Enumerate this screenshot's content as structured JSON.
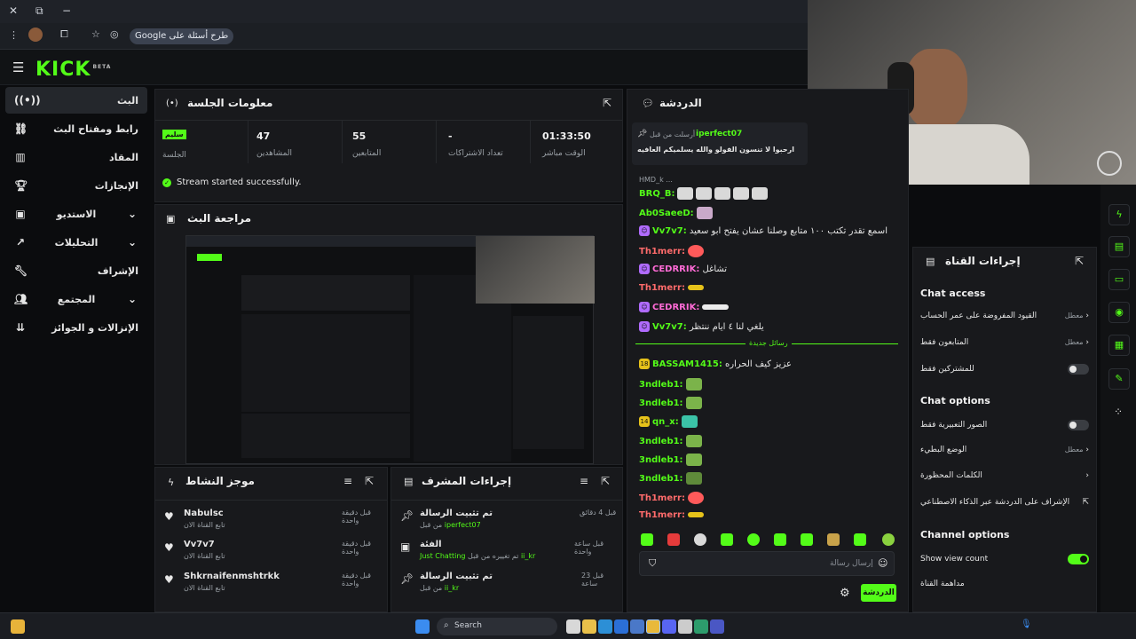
{
  "browser": {
    "address_pill": "Google طرح أسئلة على"
  },
  "kick": {
    "logo": "KICK",
    "logo_sup": "BETA"
  },
  "sidebar": {
    "items": [
      {
        "label": "البث",
        "icon": "broadcast-icon"
      },
      {
        "label": "رابط ومفتاح البث",
        "icon": "link-icon"
      },
      {
        "label": "المقاد",
        "icon": "chart-icon"
      },
      {
        "label": "الإنجازات",
        "icon": "trophy-icon"
      },
      {
        "label": "الاستديو",
        "icon": "studio-icon"
      },
      {
        "label": "التحليلات",
        "icon": "analytics-icon"
      },
      {
        "label": "الإشراف",
        "icon": "wrench-icon"
      },
      {
        "label": "المجتمع",
        "icon": "community-icon"
      },
      {
        "label": "الإنزالات و الجوائز",
        "icon": "drops-icon"
      }
    ]
  },
  "session": {
    "title": "معلومات الجلسة",
    "stats": [
      {
        "value": "01:33:50",
        "label": "الوقت مباشر"
      },
      {
        "value": "-",
        "label": "تعداد الاشتراكات"
      },
      {
        "value": "55",
        "label": "المتابعين"
      },
      {
        "value": "47",
        "label": "المشاهدين"
      },
      {
        "value": "سليم",
        "label": "الجلسة"
      }
    ],
    "status": "Stream started successfully."
  },
  "preview": {
    "title": "مراجعة البث"
  },
  "activity": {
    "title": "موجز النشاط",
    "items": [
      {
        "name": "Nabulsc",
        "sub": "تابع القناة الان",
        "time": "قبل دقيقة واحدة"
      },
      {
        "name": "Vv7v7",
        "sub": "تابع القناة الان",
        "time": "قبل دقيقة واحدة"
      },
      {
        "name": "Shkrnaifenmshtrkk",
        "sub": "تابع القناة الان",
        "time": "قبل دقيقة واحدة"
      }
    ]
  },
  "mod": {
    "title": "إجراءات المشرف",
    "items": [
      {
        "title": "تم تثبيت الرسالة",
        "sub_prefix": "من قبل",
        "user": "iperfect07",
        "time": "قبل 4 دقائق"
      },
      {
        "title": "الفئة",
        "sub_prefix": "تم تغييره من قبل",
        "user": "ii_kr",
        "extra": "Just Chatting",
        "time": "قبل ساعة واحدة"
      },
      {
        "title": "تم تثبيت الرسالة",
        "sub_prefix": "من قبل",
        "user": "ii_kr",
        "time": "قبل 23 ساعة"
      }
    ]
  },
  "chat": {
    "title": "الدردشة",
    "pinned_header": "أرسلت من قبل",
    "pinned_user": "iperfect07",
    "pinned_text": "ارحبوا لا تنسون الفولو والله يسلميكم العافيه",
    "reply_hint": "HMD_k ...",
    "messages": [
      {
        "user": "BRQ_B:",
        "color": "#53fc18",
        "text": ""
      },
      {
        "user": "Ab0SaeeD:",
        "color": "#53fc18",
        "text": ""
      },
      {
        "user": "Vv7v7:",
        "color": "#53fc18",
        "text": "اسمع تقدر تكتب ١٠٠ متابع وصلنا عشان يفتح ابو سعيد"
      },
      {
        "user": "Th1merr:",
        "color": "#ff6b6b",
        "text": ""
      },
      {
        "user": "CEDRRIK:",
        "color": "#ff6bd6",
        "text": "تشاغل"
      },
      {
        "user": "Th1merr:",
        "color": "#ff6b6b",
        "text": ""
      },
      {
        "user": "CEDRRIK:",
        "color": "#ff6bd6",
        "text": ""
      },
      {
        "user": "Vv7v7:",
        "color": "#53fc18",
        "text": "يلغي لنا ٤ ايام ننتظر"
      }
    ],
    "new_messages": "رسائل جديدة",
    "messages2": [
      {
        "user": "BASSAM1415:",
        "color": "#53fc18",
        "text": "عزيز كيف الحراره",
        "badge": "18"
      },
      {
        "user": "3ndleb1:",
        "color": "#53fc18",
        "text": ""
      },
      {
        "user": "3ndleb1:",
        "color": "#53fc18",
        "text": ""
      },
      {
        "user": "qn_x:",
        "color": "#53fc18",
        "text": "",
        "badge": "14"
      },
      {
        "user": "3ndleb1:",
        "color": "#53fc18",
        "text": ""
      },
      {
        "user": "3ndleb1:",
        "color": "#53fc18",
        "text": ""
      },
      {
        "user": "3ndleb1:",
        "color": "#53fc18",
        "text": ""
      },
      {
        "user": "Th1merr:",
        "color": "#ff6b6b",
        "text": ""
      },
      {
        "user": "Th1merr:",
        "color": "#ff6b6b",
        "text": ""
      }
    ],
    "input_placeholder": "إرسال رسالة",
    "send_label": "الدردشة"
  },
  "channel_actions": {
    "title": "إجراءات القناة",
    "chat_access": "Chat access",
    "rows_access": [
      {
        "label": "القيود المفروضة على عمر الحساب",
        "value": "معطل",
        "ctrl": "chevron"
      },
      {
        "label": "المتابعون فقط",
        "value": "معطل",
        "ctrl": "chevron"
      },
      {
        "label": "للمشتركين فقط",
        "value": "",
        "ctrl": "toggle-off"
      }
    ],
    "chat_options": "Chat options",
    "rows_options": [
      {
        "label": "الصور التعبيرية فقط",
        "value": "",
        "ctrl": "toggle-off"
      },
      {
        "label": "الوضع البطيء",
        "value": "معطل",
        "ctrl": "chevron"
      },
      {
        "label": "الكلمات المحظورة",
        "value": "",
        "ctrl": "chevron"
      },
      {
        "label": "الإشراف على الدردشة عبر الذكاء الاصطناعي",
        "value": "",
        "ctrl": "external"
      }
    ],
    "channel_options": "Channel options",
    "show_view_count": "Show view count",
    "channel_watch": "مداهمة القناة"
  },
  "taskbar": {
    "search": "Search"
  },
  "colors": {
    "accent": "#53fc18",
    "panel": "#18191c",
    "bg": "#0b0c0e"
  }
}
